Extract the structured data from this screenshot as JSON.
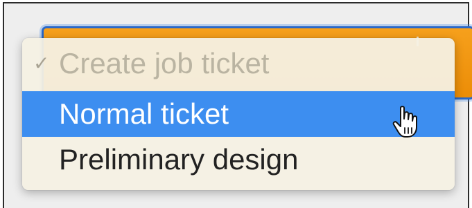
{
  "popup_button": {
    "background_color": "#f19a12",
    "focus_ring_color": "#2a68c8"
  },
  "menu": {
    "items": [
      {
        "label": "Create job ticket",
        "checked": true,
        "state": "disabled"
      },
      {
        "label": "Normal ticket",
        "checked": false,
        "state": "highlighted"
      },
      {
        "label": "Preliminary design",
        "checked": false,
        "state": "normal"
      }
    ],
    "check_glyph": "✓",
    "highlight_color": "#3d8ef0"
  },
  "cursor": {
    "icon": "pointing-hand-cursor-icon"
  }
}
